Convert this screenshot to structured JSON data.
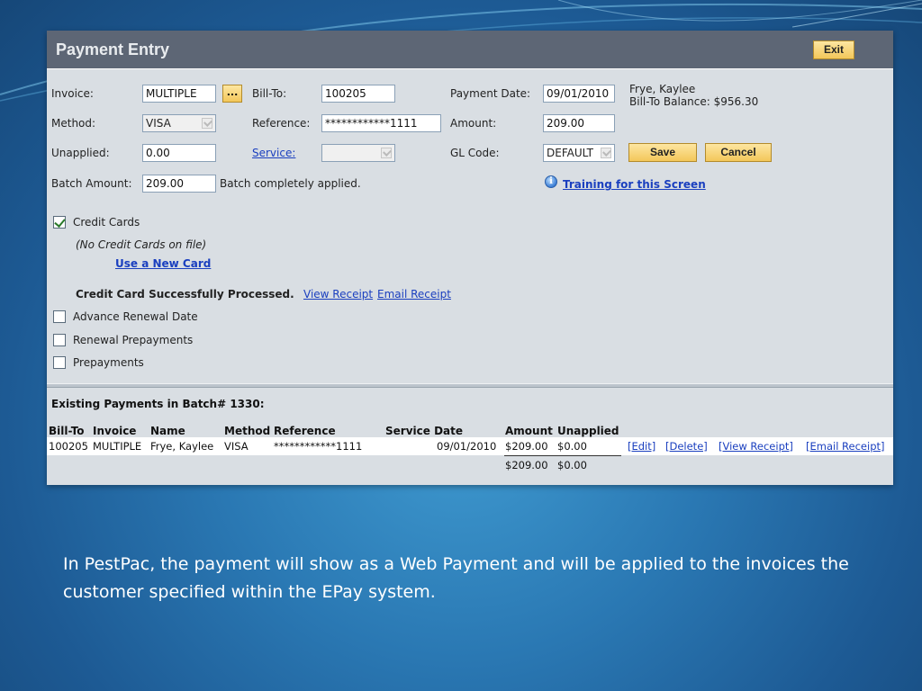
{
  "window": {
    "title": "Payment Entry",
    "exit_label": "Exit"
  },
  "form": {
    "invoice_label": "Invoice:",
    "invoice_value": "MULTIPLE",
    "lookup_label": "...",
    "billto_label": "Bill-To:",
    "billto_value": "100205",
    "payment_date_label": "Payment Date:",
    "payment_date_value": "09/01/2010",
    "customer_name": "Frye, Kaylee",
    "billto_balance": "Bill-To Balance: $956.30",
    "method_label": "Method:",
    "method_value": "VISA",
    "reference_label": "Reference:",
    "reference_value": "************1111",
    "amount_label": "Amount:",
    "amount_value": "209.00",
    "unapplied_label": "Unapplied:",
    "unapplied_value": "0.00",
    "service_label": "Service:",
    "service_value": "",
    "glcode_label": "GL Code:",
    "glcode_value": "DEFAULT",
    "save_label": "Save",
    "cancel_label": "Cancel",
    "batch_amount_label": "Batch Amount:",
    "batch_amount_value": "209.00",
    "batch_status": "Batch completely applied.",
    "training_link": "Training for this Screen",
    "credit_cards_label": "Credit Cards",
    "credit_cards_checked": true,
    "no_cards_text": "(No Credit Cards on file)",
    "use_new_card_link": "Use a New Card",
    "processed_text": "Credit Card Successfully Processed.",
    "view_receipt_link": "View Receipt",
    "email_receipt_link": "Email Receipt",
    "advance_renewal_label": "Advance Renewal Date",
    "renewal_prepayments_label": "Renewal Prepayments",
    "prepayments_label": "Prepayments"
  },
  "batch": {
    "header": "Existing Payments in Batch# 1330:",
    "columns": [
      "Bill-To",
      "Invoice",
      "Name",
      "Method",
      "Reference",
      "Service Date",
      "Amount",
      "Unapplied"
    ],
    "rows": [
      {
        "billto": "100205",
        "invoice": "MULTIPLE",
        "name": "Frye, Kaylee",
        "method": "VISA",
        "reference": "************1111",
        "service_date": "09/01/2010",
        "amount": "$209.00",
        "unapplied": "$0.00",
        "actions": [
          "[Edit]",
          "[Delete]",
          "[View Receipt]",
          "[Email Receipt]"
        ]
      }
    ],
    "totals": {
      "amount": "$209.00",
      "unapplied": "$0.00"
    }
  },
  "caption": "In PestPac, the payment will show as a Web Payment and will be applied to the invoices the customer specified within the EPay system.",
  "colors": {
    "background": "#2a78b3",
    "titlebar": "#5d6675",
    "panel": "#d9dee3",
    "button": "#f3c75a",
    "link": "#1a3fbf"
  }
}
